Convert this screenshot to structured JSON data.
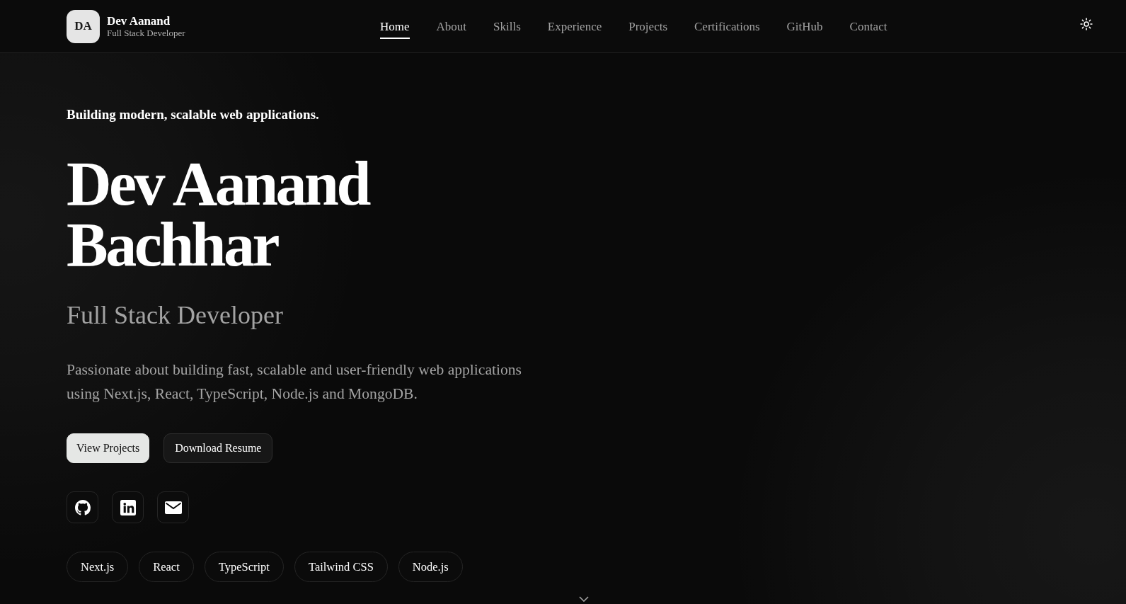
{
  "header": {
    "logo": {
      "initials": "DA",
      "name": "Dev Aanand",
      "subtitle": "Full Stack Developer"
    },
    "nav": [
      {
        "label": "Home",
        "selected": true
      },
      {
        "label": "About",
        "selected": false
      },
      {
        "label": "Skills",
        "selected": false
      },
      {
        "label": "Experience",
        "selected": false
      },
      {
        "label": "Projects",
        "selected": false
      },
      {
        "label": "Certifications",
        "selected": false
      },
      {
        "label": "GitHub",
        "selected": false
      },
      {
        "label": "Contact",
        "selected": false
      }
    ]
  },
  "hero": {
    "tagline": "Building modern, scalable web applications.",
    "name": "Dev Aanand Bachhar",
    "role": "Full Stack Developer",
    "description": "Passionate about building fast, scalable and user-friendly web applications using Next.js, React, TypeScript, Node.js and MongoDB.",
    "buttons": [
      {
        "label": "View Projects",
        "kind": "primary"
      },
      {
        "label": "Download Resume",
        "kind": "secondary"
      }
    ],
    "tags": [
      "Next.js",
      "React",
      "TypeScript",
      "Tailwind CSS",
      "Node.js"
    ]
  }
}
